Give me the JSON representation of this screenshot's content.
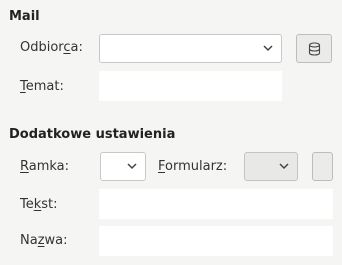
{
  "mail": {
    "heading": "Mail",
    "recipient": {
      "label_pre": "Odbior",
      "label_mn": "c",
      "label_post": "a:",
      "value": ""
    },
    "subject": {
      "label_pre": "",
      "label_mn": "T",
      "label_post": "emat:",
      "value": ""
    },
    "address_book_icon": "database-icon"
  },
  "additional": {
    "heading": "Dodatkowe ustawienia",
    "frame": {
      "label_pre": "",
      "label_mn": "R",
      "label_post": "amka:",
      "value": ""
    },
    "form": {
      "label_pre": "",
      "label_mn": "F",
      "label_post": "ormularz:",
      "value": ""
    },
    "text": {
      "label_pre": "Te",
      "label_mn": "k",
      "label_post": "st:",
      "value": ""
    },
    "name": {
      "label_pre": "Na",
      "label_mn": "z",
      "label_post": "wa:",
      "value": ""
    }
  }
}
